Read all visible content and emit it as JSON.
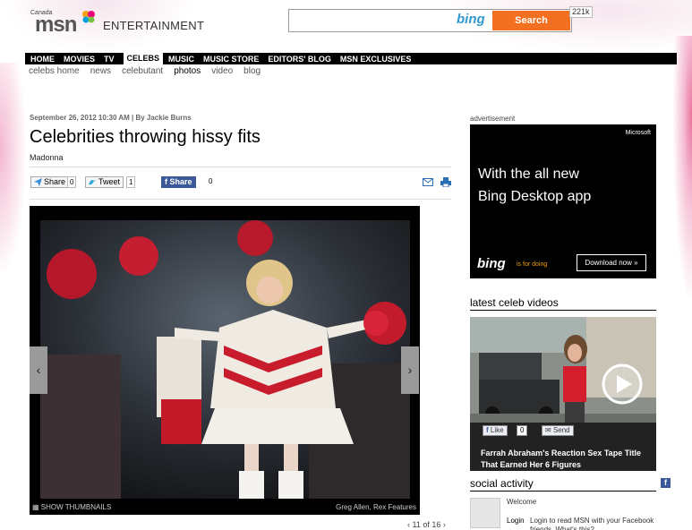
{
  "header": {
    "country": "Canada",
    "logo": "msn",
    "section": "ENTERTAINMENT",
    "search_button": "Search",
    "search_brand": "bing",
    "counter": "221k"
  },
  "nav": {
    "items": [
      {
        "label": "HOME",
        "active": false
      },
      {
        "label": "MOVIES",
        "active": false
      },
      {
        "label": "TV",
        "active": false
      },
      {
        "label": "CELEBS",
        "active": true
      },
      {
        "label": "MUSIC",
        "active": false
      },
      {
        "label": "MUSIC STORE",
        "active": false
      },
      {
        "label": "EDITORS' BLOG",
        "active": false
      },
      {
        "label": "MSN EXCLUSIVES",
        "active": false
      }
    ],
    "subitems": [
      {
        "label": "celebs home",
        "active": false
      },
      {
        "label": "news",
        "active": false
      },
      {
        "label": "celebutant",
        "active": false
      },
      {
        "label": "photos",
        "active": true
      },
      {
        "label": "video",
        "active": false
      },
      {
        "label": "blog",
        "active": false
      }
    ]
  },
  "article": {
    "byline": "September 26, 2012 10:30 AM | By Jackie Burns",
    "title": "Celebrities throwing hissy fits",
    "subtitle": "Madonna",
    "share": {
      "share_label": "Share",
      "share_count": "0",
      "tweet_label": "Tweet",
      "tweet_count": "1",
      "fb_label": "Share",
      "fb_count": "0"
    },
    "gallery": {
      "thumbnails_label": "SHOW THUMBNAILS",
      "credit": "Greg Allen, Rex Features",
      "pager": "‹ 11 of 16 ›",
      "prev_arrow": "‹",
      "next_arrow": "›"
    }
  },
  "sidebar": {
    "ad_label": "advertisement",
    "ad": {
      "brand": "Microsoft",
      "headline_line1": "With the all new",
      "headline_line2": "Bing Desktop app",
      "bing": "bing",
      "tagline": "is for doing",
      "download": "Download now »"
    },
    "videos_title": "latest celeb videos",
    "video": {
      "like_label": "Like",
      "like_count": "0",
      "send_label": "Send",
      "caption": "Farrah Abraham's Reaction Sex Tape Title That Earned Her 6 Figures"
    },
    "social_title": "social activity",
    "welcome": "Welcome",
    "login": "Login",
    "login_text": "Login to read MSN with your Facebook friends. What's this?"
  },
  "colors": {
    "search_orange": "#f37021",
    "facebook_blue": "#3b5998",
    "bing_blue": "#3399cc"
  }
}
